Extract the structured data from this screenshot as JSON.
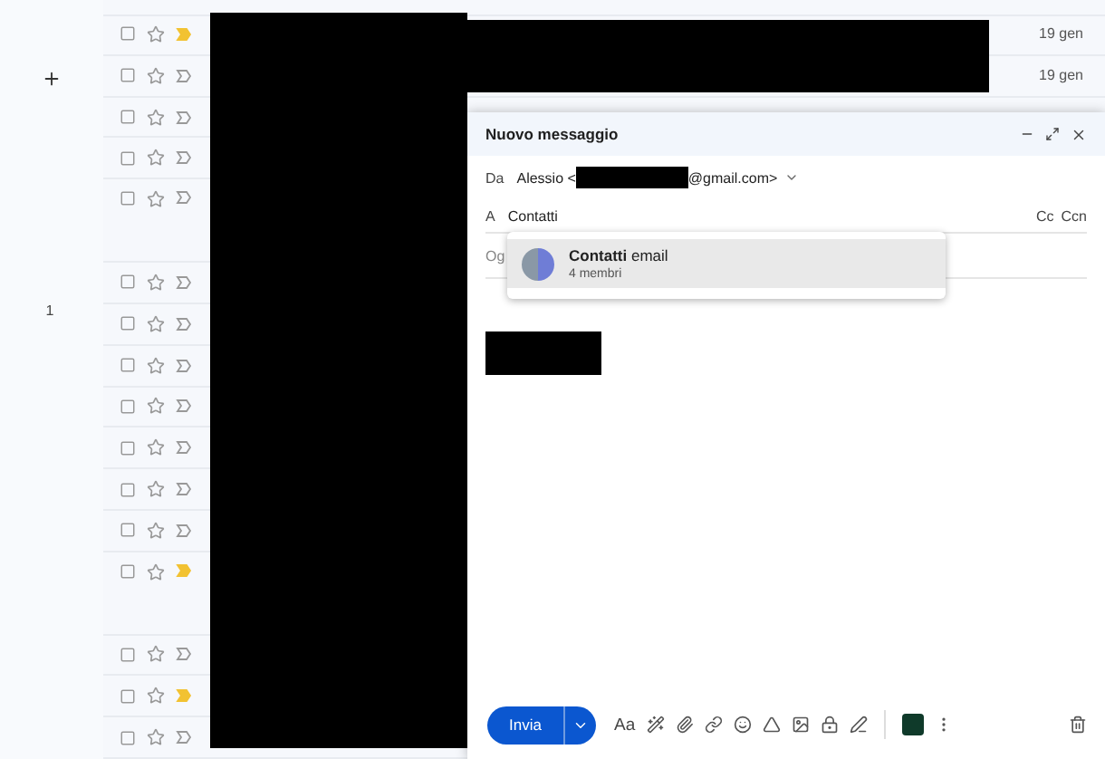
{
  "sidebar": {
    "count": "1"
  },
  "mail_rows": [
    {
      "kind": "single",
      "checked": false,
      "starred": false,
      "important": true,
      "date": "19 gen"
    },
    {
      "kind": "single",
      "checked": false,
      "starred": false,
      "important": false,
      "date": "19 gen"
    },
    {
      "kind": "single",
      "checked": false,
      "starred": false,
      "important": false
    },
    {
      "kind": "single",
      "checked": false,
      "starred": false,
      "important": false
    },
    {
      "kind": "double",
      "checked": false,
      "starred": false,
      "important": false
    },
    {
      "kind": "single",
      "checked": false,
      "starred": false,
      "important": false
    },
    {
      "kind": "single",
      "checked": false,
      "starred": false,
      "important": false
    },
    {
      "kind": "single",
      "checked": false,
      "starred": false,
      "important": false
    },
    {
      "kind": "single",
      "checked": false,
      "starred": false,
      "important": false
    },
    {
      "kind": "single",
      "checked": false,
      "starred": false,
      "important": false
    },
    {
      "kind": "single",
      "checked": false,
      "starred": false,
      "important": false
    },
    {
      "kind": "single",
      "checked": false,
      "starred": false,
      "important": false
    },
    {
      "kind": "double",
      "checked": false,
      "starred": false,
      "important": true
    },
    {
      "kind": "single",
      "checked": false,
      "starred": false,
      "important": false
    },
    {
      "kind": "single",
      "checked": false,
      "starred": false,
      "important": true
    },
    {
      "kind": "single",
      "checked": false,
      "starred": false,
      "important": false
    }
  ],
  "compose": {
    "title": "Nuovo messaggio",
    "from": {
      "label": "Da",
      "name": "Alessio <",
      "domain": "@gmail.com>"
    },
    "to": {
      "label": "A",
      "value": "Contatti",
      "cc": "Cc",
      "bcc": "Ccn"
    },
    "subject": {
      "visible_text": "Og"
    },
    "suggestions": [
      {
        "name": "**Contatti** email",
        "detail": "4 membri",
        "selected": true
      }
    ],
    "toolbar": {
      "send": "Invia",
      "format": "Aa"
    }
  }
}
